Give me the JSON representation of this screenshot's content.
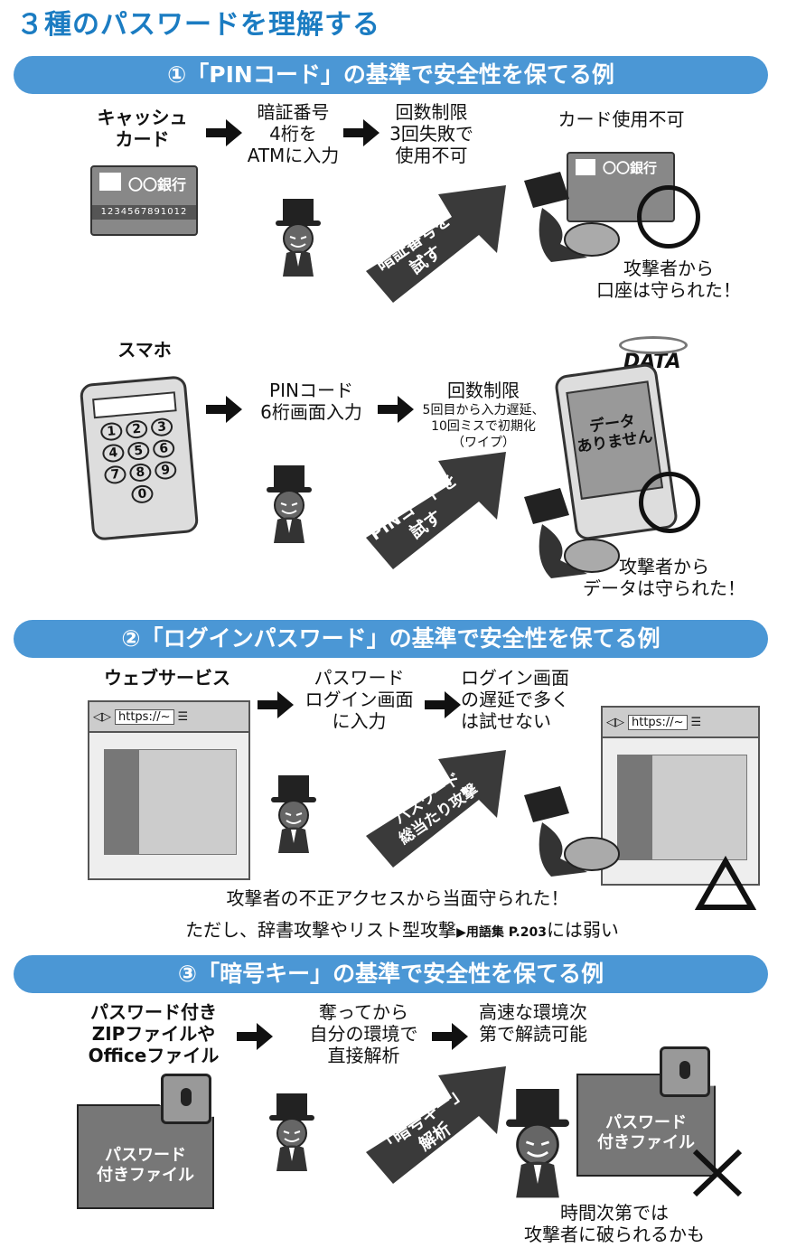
{
  "title": "３種のパスワードを理解する",
  "sections": [
    {
      "banner": "①「PINコード」の基準で安全性を保てる例",
      "rows": [
        {
          "target": "キャッシュ\nカード",
          "step1": "暗証番号\n4桁を\nATMに入力",
          "step2_title": "回数制限\n3回失敗で\n使用不可",
          "result_header": "カード使用不可",
          "attack": "暗証番号を\n試す",
          "card_bank": "〇〇銀行",
          "card_number": "1234567891012",
          "result": "攻撃者から\n口座は守られた！"
        },
        {
          "target": "スマホ",
          "step1": "PINコード\n6桁画面入力",
          "step2_title": "回数制限",
          "step2_detail": "5回目から入力遅延、\n10回ミスで初期化\n（ワイプ）",
          "attack": "PINコードを\n試す",
          "keypad": [
            "1",
            "2",
            "3",
            "4",
            "5",
            "6",
            "7",
            "8",
            "9",
            "0"
          ],
          "data_label": "DATA",
          "screen_text": "データ\nありません",
          "result": "攻撃者から\nデータは守られた！"
        }
      ]
    },
    {
      "banner": "②「ログインパスワード」の基準で安全性を保てる例",
      "target": "ウェブサービス",
      "step1": "パスワード\nログイン画面\nに入力",
      "step2": "ログイン画面\nの遅延で多く\nは試せない",
      "url": "https://~",
      "attack": "パスワード\n総当たり攻撃",
      "result_line1": "攻撃者の不正アクセスから当面守られた！",
      "result_line2_a": "ただし、辞書攻撃やリスト型攻撃",
      "result_line2_ref": "▶用語集 P.203",
      "result_line2_b": "には弱い"
    },
    {
      "banner": "③「暗号キー」の基準で安全性を保てる例",
      "target": "パスワード付き\nZIPファイルや\nOfficeファイル",
      "step1": "奪ってから\n自分の環境で\n直接解析",
      "step2": "高速な環境次\n第で解読可能",
      "file_label": "パスワード\n付きファイル",
      "attack": "「暗号キー」\n解析",
      "result": "時間次第では\n攻撃者に破られるかも"
    }
  ],
  "colors": {
    "accent": "#1b7cc2",
    "banner": "#4b97d5",
    "arrow": "#3a3a3a"
  }
}
